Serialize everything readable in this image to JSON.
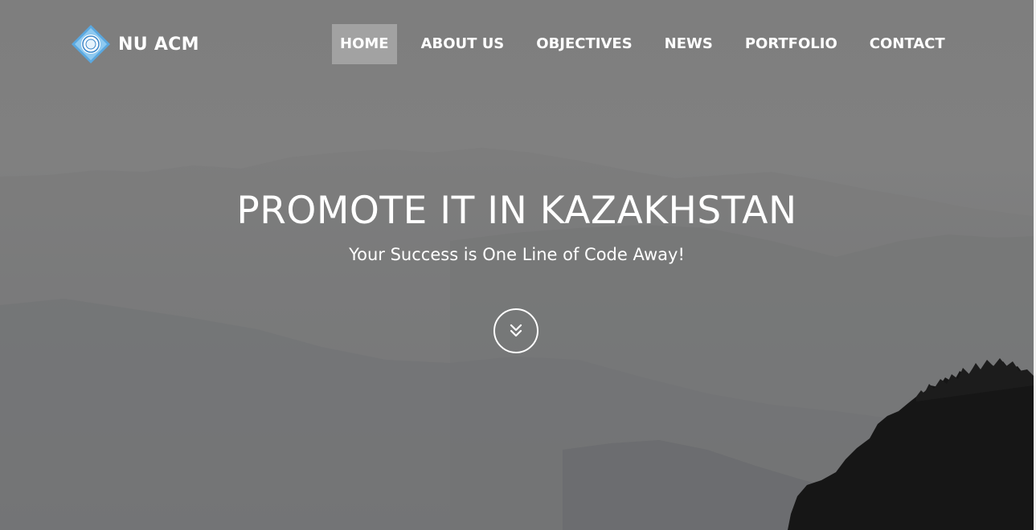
{
  "brand": {
    "name": "NU ACM",
    "logo_icon": "acm-diamond-logo-icon",
    "logo_color": "#5aa8e0"
  },
  "nav": {
    "items": [
      {
        "label": "HOME",
        "active": true
      },
      {
        "label": "ABOUT US",
        "active": false
      },
      {
        "label": "OBJECTIVES",
        "active": false
      },
      {
        "label": "NEWS",
        "active": false
      },
      {
        "label": "PORTFOLIO",
        "active": false
      },
      {
        "label": "CONTACT",
        "active": false
      }
    ]
  },
  "hero": {
    "title": "PROMOTE IT IN KAZAKHSTAN",
    "subtitle": "Your Success is One Line of Code Away!",
    "scroll_icon": "double-chevron-down-icon"
  },
  "colors": {
    "text": "#ffffff",
    "background": "#7e7e7e"
  }
}
